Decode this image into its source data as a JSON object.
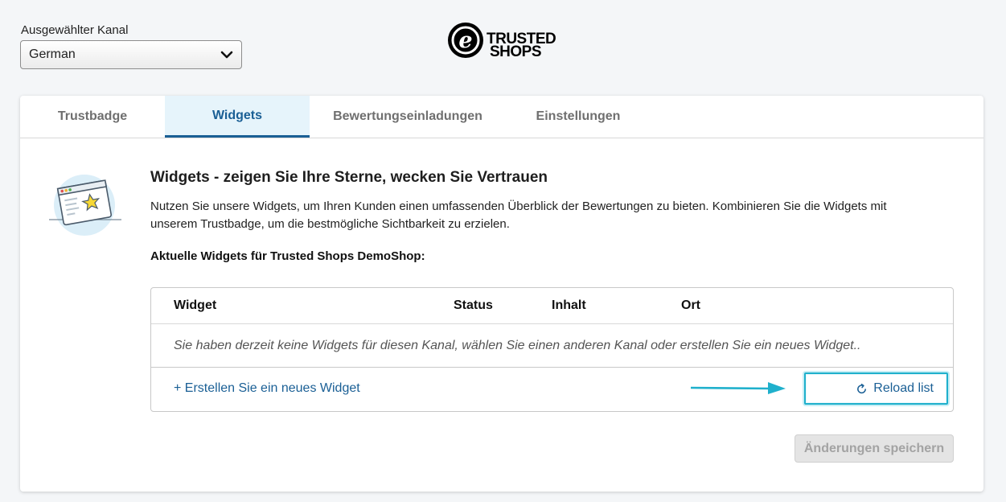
{
  "channel": {
    "label": "Ausgewählter Kanal",
    "selected": "German"
  },
  "logo": {
    "line1": "TRUSTED",
    "line2": "SHOPS"
  },
  "tabs": [
    {
      "label": "Trustbadge"
    },
    {
      "label": "Widgets"
    },
    {
      "label": "Bewertungseinladungen"
    },
    {
      "label": "Einstellungen"
    }
  ],
  "main": {
    "heading": "Widgets - zeigen Sie Ihre Sterne, wecken Sie Vertrauen",
    "intro": "Nutzen Sie unsere Widgets, um Ihren Kunden einen umfassenden Überblick der Bewertungen zu bieten. Kombinieren Sie die Widgets mit unserem Trustbadge, um die bestmögliche Sichtbarkeit zu erzielen.",
    "current_label": "Aktuelle Widgets für Trusted Shops DemoShop:"
  },
  "table": {
    "columns": [
      "Widget",
      "Status",
      "Inhalt",
      "Ort"
    ],
    "empty_message": "Sie haben derzeit keine Widgets für diesen Kanal, wählen Sie einen anderen Kanal oder erstellen Sie ein neues Widget..",
    "create_link": "+ Erstellen Sie ein neues Widget",
    "reload_label": "Reload list"
  },
  "save_label": "Änderungen speichern",
  "colors": {
    "accent": "#1a5f95",
    "highlight": "#1fb0cc",
    "active_tab_bg": "#e6f4fb"
  }
}
